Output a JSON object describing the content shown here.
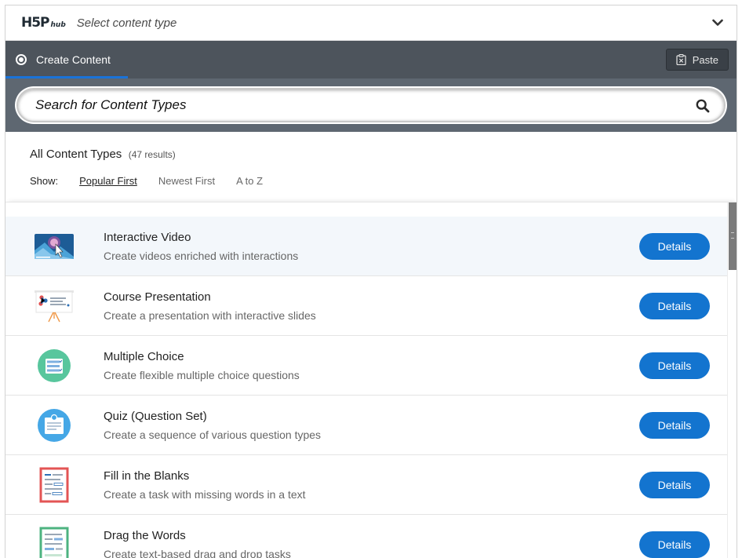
{
  "header": {
    "logo_main": "H5P",
    "logo_sub": "hub",
    "title": "Select content type",
    "toggle_icon": "chevron-down-icon"
  },
  "tabs": {
    "active_label": "Create Content",
    "paste_label": "Paste"
  },
  "search": {
    "placeholder": "Search for Content Types",
    "value": ""
  },
  "results": {
    "title": "All Content Types",
    "count": "(47 results)",
    "show_label": "Show:",
    "sort_options": [
      "Popular First",
      "Newest First",
      "A to Z"
    ],
    "selected_sort": "Popular First"
  },
  "items": [
    {
      "title": "Interactive Video",
      "desc": "Create videos enriched with interactions",
      "button": "Details",
      "icon": "interactive-video-icon"
    },
    {
      "title": "Course Presentation",
      "desc": "Create a presentation with interactive slides",
      "button": "Details",
      "icon": "course-presentation-icon"
    },
    {
      "title": "Multiple Choice",
      "desc": "Create flexible multiple choice questions",
      "button": "Details",
      "icon": "multiple-choice-icon"
    },
    {
      "title": "Quiz (Question Set)",
      "desc": "Create a sequence of various question types",
      "button": "Details",
      "icon": "quiz-icon"
    },
    {
      "title": "Fill in the Blanks",
      "desc": "Create a task with missing words in a text",
      "button": "Details",
      "icon": "fill-in-the-blanks-icon"
    },
    {
      "title": "Drag the Words",
      "desc": "Create text-based drag and drop tasks",
      "button": "Details",
      "icon": "drag-the-words-icon"
    }
  ],
  "colors": {
    "accent": "#1374cf",
    "tabbar": "#4d545c",
    "search_area": "#5e6771"
  }
}
